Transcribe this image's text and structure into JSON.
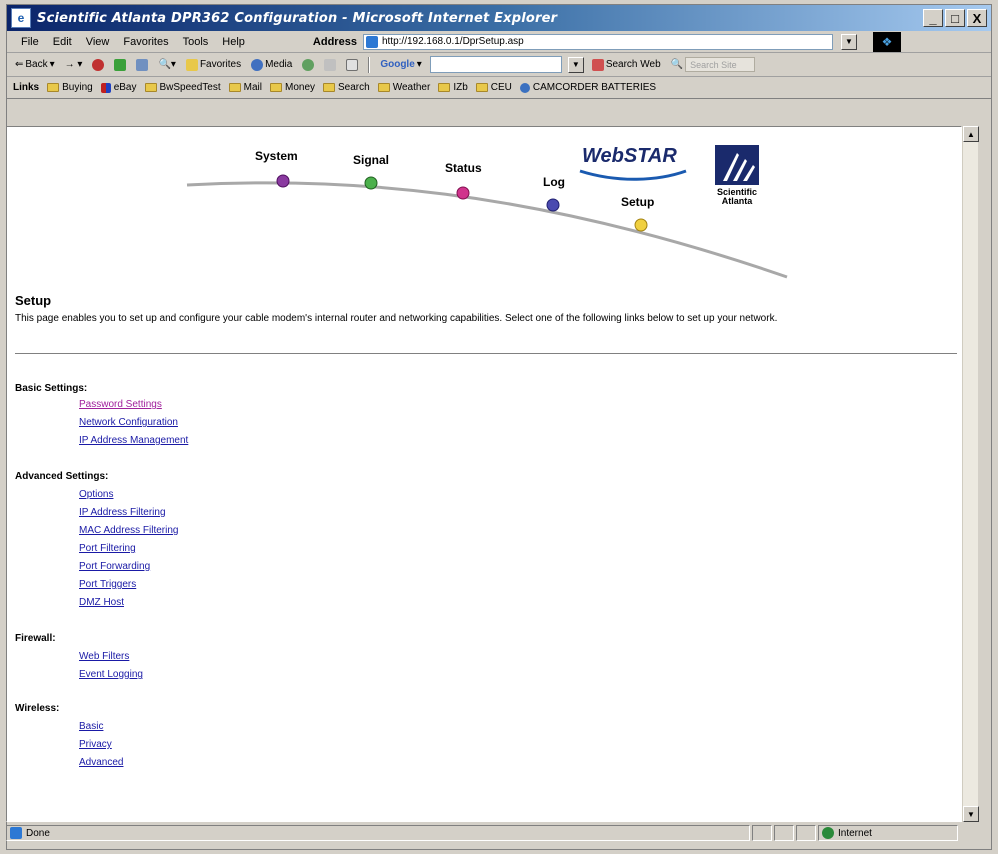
{
  "window": {
    "title": "Scientific Atlanta DPR362 Configuration - Microsoft Internet Explorer",
    "minimize": "_",
    "maximize": "□",
    "close": "X"
  },
  "menu": [
    "File",
    "Edit",
    "View",
    "Favorites",
    "Tools",
    "Help"
  ],
  "address": {
    "label": "Address",
    "url": "http://192.168.0.1/DprSetup.asp"
  },
  "toolbar": {
    "back": "Back",
    "favorites": "Favorites",
    "media": "Media",
    "google": "Google",
    "search_web": "Search Web",
    "search_site": "Search Site"
  },
  "links": {
    "label": "Links",
    "items": [
      "Buying",
      "eBay",
      "BwSpeedTest",
      "Mail",
      "Money",
      "Search",
      "Weather",
      "IZb",
      "CEU",
      "CAMCORDER BATTERIES"
    ]
  },
  "nav": {
    "items": [
      {
        "label": "System",
        "color": "#8a3aa0"
      },
      {
        "label": "Signal",
        "color": "#4cb04c"
      },
      {
        "label": "Status",
        "color": "#d0338c"
      },
      {
        "label": "Log",
        "color": "#4a4ab0"
      },
      {
        "label": "Setup",
        "color": "#f0d040"
      }
    ],
    "webstar": "WebSTAR",
    "sa_line1": "Scientific",
    "sa_line2": "Atlanta"
  },
  "page": {
    "title": "Setup",
    "intro": "This page enables you to set up and configure your cable modem's internal router and networking capabilities.  Select one of the following links below to set up your network."
  },
  "sections": {
    "basic": {
      "heading": "Basic Settings:",
      "links": [
        "Password Settings",
        "Network Configuration",
        "IP Address Management"
      ]
    },
    "advanced": {
      "heading": "Advanced Settings:",
      "links": [
        "Options",
        "IP Address Filtering",
        "MAC Address Filtering",
        "Port Filtering",
        "Port Forwarding",
        "Port Triggers",
        "DMZ Host"
      ]
    },
    "firewall": {
      "heading": "Firewall:",
      "links": [
        "Web Filters",
        "Event Logging"
      ]
    },
    "wireless": {
      "heading": "Wireless:",
      "links": [
        "Basic",
        "Privacy",
        "Advanced"
      ]
    }
  },
  "status": {
    "text": "Done",
    "zone": "Internet"
  }
}
